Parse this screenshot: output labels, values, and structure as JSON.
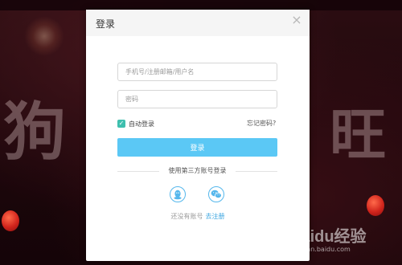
{
  "modal": {
    "title": "登录",
    "close_glyph": "×"
  },
  "form": {
    "username_placeholder": "手机号/注册邮箱/用户名",
    "password_placeholder": "密码",
    "remember_label": "自动登录",
    "remember_checked": true,
    "forgot_label": "忘记密码?",
    "login_label": "登录"
  },
  "third_party": {
    "label": "使用第三方账号登录",
    "providers": [
      "qq-icon",
      "wechat-icon"
    ]
  },
  "register": {
    "prompt": "还没有账号",
    "link": "去注册"
  },
  "background": {
    "watermark": "Baidu经验",
    "watermark_sub": "jingyan.baidu.com"
  },
  "colors": {
    "accent": "#5bc8f5",
    "checkbox": "#3ebfae",
    "link": "#3aa5e0",
    "icon": "#55b7ec"
  }
}
